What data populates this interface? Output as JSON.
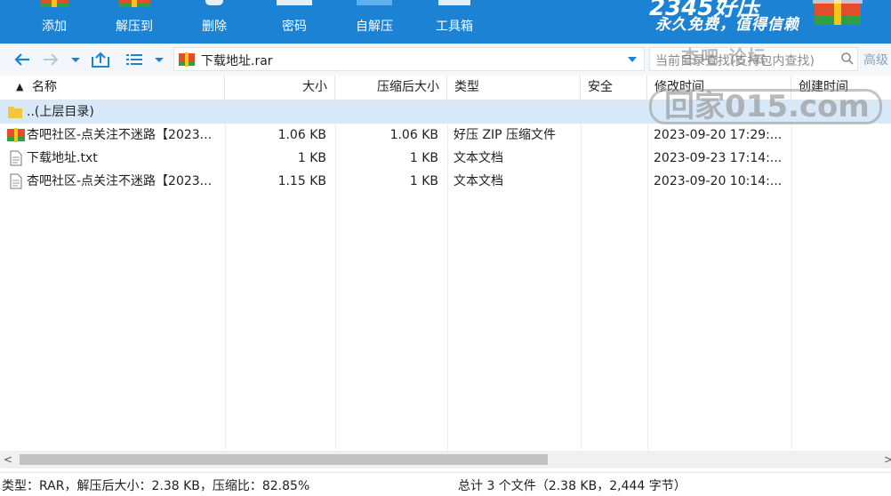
{
  "toolbar": {
    "buttons": [
      {
        "label": "添加",
        "icon": "add-archive-icon"
      },
      {
        "label": "解压到",
        "icon": "extract-to-icon"
      },
      {
        "label": "删除",
        "icon": "delete-icon"
      },
      {
        "label": "密码",
        "icon": "password-icon"
      },
      {
        "label": "自解压",
        "icon": "self-extract-icon"
      },
      {
        "label": "工具箱",
        "icon": "toolbox-icon"
      }
    ],
    "brand_slogan": "永久免费，值得信赖",
    "brand_logo_text": "2345好压"
  },
  "addressbar": {
    "path": "下载地址.rar",
    "search_placeholder": "当前目录查找(支持包内查找)",
    "advanced_label": "高级"
  },
  "columns": {
    "name": "名称",
    "size": "大小",
    "packed": "压缩后大小",
    "type": "类型",
    "security": "安全",
    "modified": "修改时间",
    "created": "创建时间"
  },
  "files": [
    {
      "name": "..(上层目录)",
      "size": "",
      "packed": "",
      "type": "",
      "security": "",
      "modified": "",
      "created": "",
      "icon": "folder-up-icon"
    },
    {
      "name": "杏吧社区-点关注不迷路【2023...",
      "size": "1.06 KB",
      "packed": "1.06 KB",
      "type": "好压 ZIP 压缩文件",
      "security": "",
      "modified": "2023-09-20 17:29:...",
      "created": "",
      "icon": "zip-archive-icon"
    },
    {
      "name": "下载地址.txt",
      "size": "1 KB",
      "packed": "1 KB",
      "type": "文本文档",
      "security": "",
      "modified": "2023-09-23 17:14:...",
      "created": "",
      "icon": "text-file-icon"
    },
    {
      "name": "杏吧社区-点关注不迷路【2023...",
      "size": "1.15 KB",
      "packed": "1 KB",
      "type": "文本文档",
      "security": "",
      "modified": "2023-09-20 10:14:...",
      "created": "",
      "icon": "text-file-icon"
    }
  ],
  "status": {
    "left": "类型：RAR，解压后大小：2.38 KB，压缩比：82.85%",
    "middle": "总计 3 个文件（2.38 KB，2,444 字节）"
  },
  "watermark": {
    "top_text": "杏吧 论坛",
    "main_text": "回家015.com"
  },
  "colors": {
    "toolbar_bg": "#1b82d4",
    "selected_row": "#d7e8f8",
    "nav_icon": "#1b82d4"
  }
}
